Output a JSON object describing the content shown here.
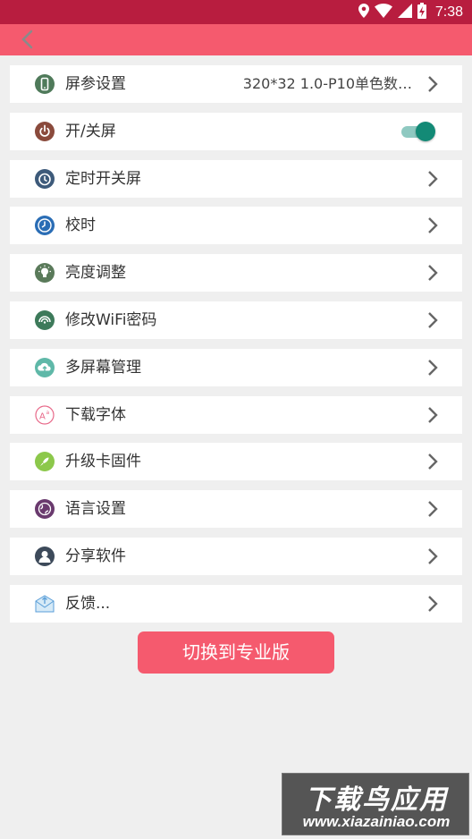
{
  "status_bar": {
    "time": "7:38",
    "icons": [
      "location-icon",
      "wifi-icon",
      "signal-icon",
      "battery-charging-icon"
    ]
  },
  "toolbar": {
    "back_icon": "back-arrow-icon"
  },
  "menu": [
    {
      "id": "screen-params",
      "label": "屏参设置",
      "value": "320*32 1.0-P10单色数…",
      "icon": "phone-icon",
      "icon_color": "#4f7a5a"
    },
    {
      "id": "screen-power",
      "label": "开/关屏",
      "toggle_on": true,
      "icon": "power-icon",
      "icon_color": "#8a4a3c"
    },
    {
      "id": "timer-power",
      "label": "定时开关屏",
      "icon": "timer-icon",
      "icon_color": "#3d5a7a"
    },
    {
      "id": "time-sync",
      "label": "校时",
      "icon": "clock-icon",
      "icon_color": "#2a6db5"
    },
    {
      "id": "brightness",
      "label": "亮度调整",
      "icon": "bulb-icon",
      "icon_color": "#5a7a5a"
    },
    {
      "id": "wifi-password",
      "label": "修改WiFi密码",
      "icon": "wifi-signal-icon",
      "icon_color": "#3d7a5a"
    },
    {
      "id": "multi-screen",
      "label": "多屏幕管理",
      "icon": "cloud-upload-icon",
      "icon_color": "#5fb8a8"
    },
    {
      "id": "download-font",
      "label": "下载字体",
      "icon": "font-icon",
      "icon_color": "#e86a8a"
    },
    {
      "id": "firmware-upgrade",
      "label": "升级卡固件",
      "icon": "rocket-icon",
      "icon_color": "#8cc84b"
    },
    {
      "id": "language",
      "label": "语言设置",
      "icon": "globe-icon",
      "icon_color": "#6a3a6e"
    },
    {
      "id": "share-app",
      "label": "分享软件",
      "icon": "user-icon",
      "icon_color": "#3d4a5a"
    },
    {
      "id": "feedback",
      "label": "反馈...",
      "icon": "mail-icon",
      "icon_color": "#5a9ed8"
    }
  ],
  "pro_button": {
    "label": "切换到专业版"
  },
  "watermark": {
    "top": "下载鸟应用",
    "bottom": "www.xiazainiao.com"
  },
  "colors": {
    "status_bar": "#b81d3f",
    "toolbar": "#f55a6e",
    "toggle_thumb": "#138a76"
  }
}
